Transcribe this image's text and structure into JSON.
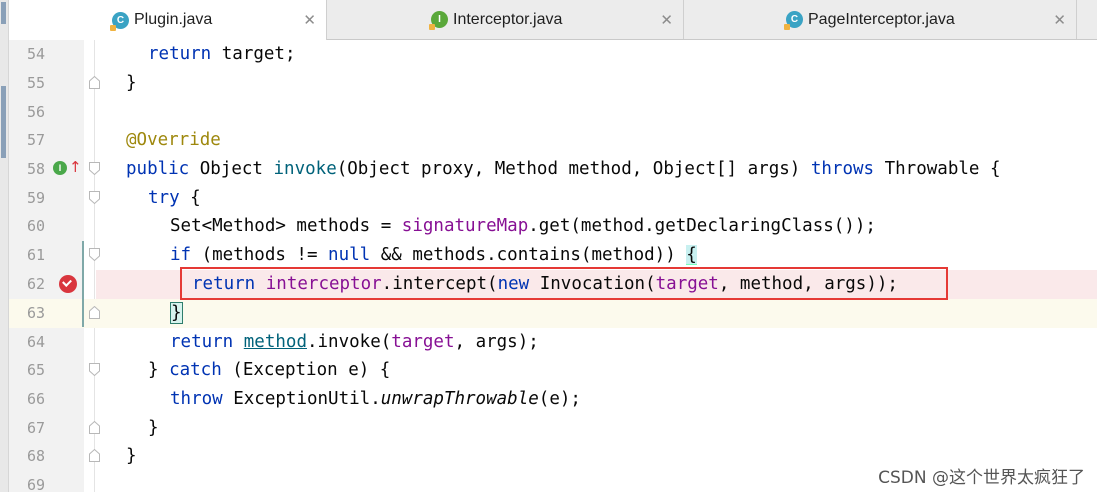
{
  "tabs": [
    {
      "label": "Plugin.java",
      "icon": "class-icon",
      "icon_letter": "C",
      "active": true
    },
    {
      "label": "Interceptor.java",
      "icon": "interface-icon",
      "icon_letter": "I",
      "active": false
    },
    {
      "label": "PageInterceptor.java",
      "icon": "class-icon",
      "icon_letter": "C",
      "active": false
    }
  ],
  "close_glyph": "✕",
  "line_numbers": [
    "54",
    "55",
    "56",
    "57",
    "58",
    "59",
    "60",
    "61",
    "62",
    "63",
    "64",
    "65",
    "66",
    "67",
    "68",
    "69"
  ],
  "code": {
    "l54": {
      "kw": "return",
      "rest": " target;"
    },
    "l55": {
      "rest": "}"
    },
    "l57": {
      "ann": "@Override"
    },
    "l58": {
      "kw1": "public",
      "t1": " Object ",
      "fn": "invoke",
      "t2": "(Object proxy, Method method, Object[] args) ",
      "kw2": "throws",
      "t3": " Throwable {"
    },
    "l59": {
      "kw": "try",
      "rest": " {"
    },
    "l60": {
      "t1": "Set<Method> methods = ",
      "fld": "signatureMap",
      "t2": ".get(method.getDeclaringClass());"
    },
    "l61": {
      "kw": "if",
      "t1": " (methods != ",
      "kw2": "null",
      "t2": " && methods.contains(method)) ",
      "brace": "{"
    },
    "l62": {
      "kw": "return",
      "sp": " ",
      "fld": "interceptor",
      "t1": ".intercept(",
      "kw2": "new",
      "t2": " Invocation(",
      "fld2": "target",
      "t3": ", method, args));"
    },
    "l63": {
      "brace": "}"
    },
    "l64": {
      "kw": "return",
      "sp": " ",
      "link": "method",
      "t1": ".invoke(",
      "fld": "target",
      "t2": ", args);"
    },
    "l65": {
      "t1": "} ",
      "kw": "catch",
      "t2": " (Exception e) {"
    },
    "l66": {
      "kw": "throw",
      "t1": " ExceptionUtil.",
      "it": "unwrapThrowable",
      "t2": "(e);"
    },
    "l67": {
      "rest": "}"
    },
    "l68": {
      "rest": "}"
    }
  },
  "gutter_icons": {
    "impl_letter": "I",
    "override_arrow": "↑"
  },
  "watermark": "CSDN @这个世界太疯狂了",
  "colors": {
    "keyword": "#0033b3",
    "annotation": "#9e880d",
    "field": "#871094",
    "method_decl": "#00627a",
    "highlight_box": "#e53935"
  }
}
